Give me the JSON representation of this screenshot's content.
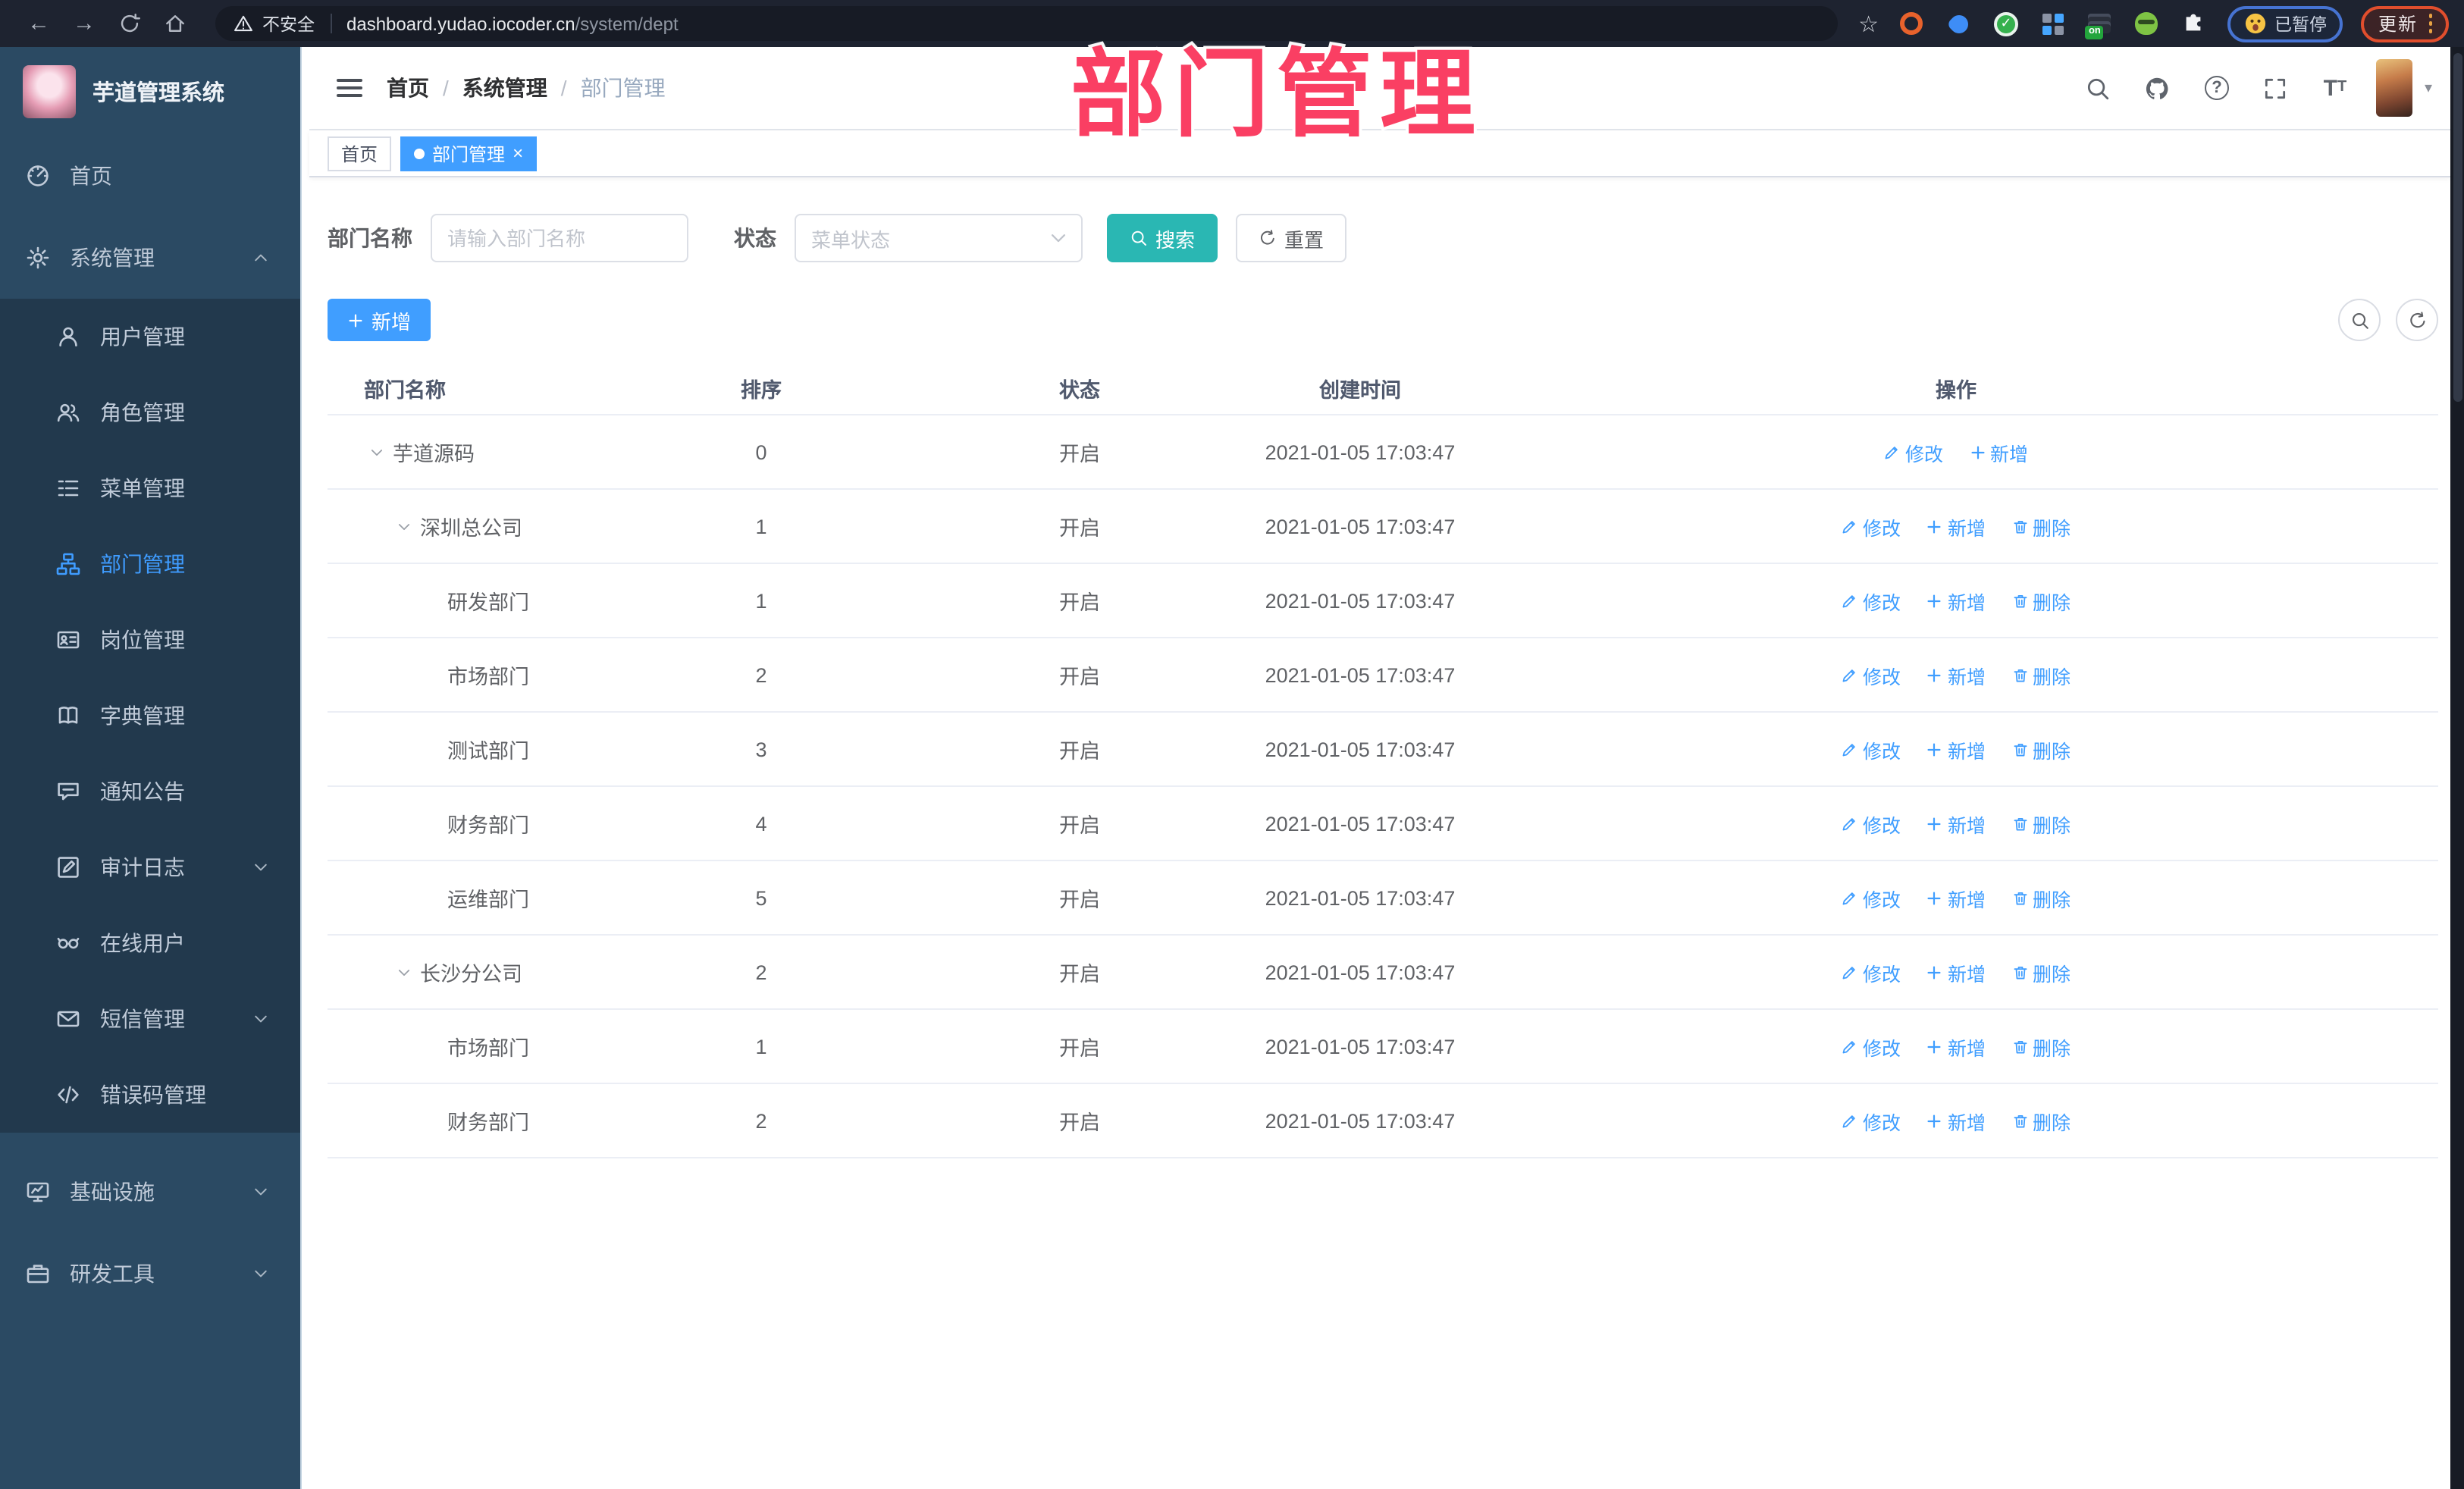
{
  "browser": {
    "nav_icons": [
      "back-icon",
      "forward-icon",
      "reload-icon",
      "home-icon"
    ],
    "security_label": "不安全",
    "url_domain": "dashboard.yudao.iocoder.cn",
    "url_path": "/system/dept",
    "bookmark_icon": "star-icon",
    "extensions": [
      "orange-ring-extension-icon",
      "blue-pin-extension-icon",
      "green-check-extension-icon",
      "grid-extension-icon",
      "panel-on-extension-icon",
      "spy-extension-icon",
      "puzzle-extensions-icon"
    ],
    "extension_badge": "on",
    "green_check": "✓",
    "paused_badge": "已暂停",
    "update_button": "更新"
  },
  "watermark": {
    "text": "部门管理",
    "color": "#fa3f63"
  },
  "sidebar": {
    "logo_title": "芋道管理系统",
    "top_items": [
      {
        "icon": "dashboard-icon",
        "label": "首页"
      },
      {
        "icon": "gear-icon",
        "label": "系统管理",
        "arrow": "up"
      }
    ],
    "submenu_items": [
      {
        "icon": "user-icon",
        "label": "用户管理"
      },
      {
        "icon": "users-icon",
        "label": "角色管理"
      },
      {
        "icon": "menu-list-icon",
        "label": "菜单管理"
      },
      {
        "icon": "org-tree-icon",
        "label": "部门管理",
        "active": true
      },
      {
        "icon": "idcard-icon",
        "label": "岗位管理"
      },
      {
        "icon": "book-icon",
        "label": "字典管理"
      },
      {
        "icon": "megaphone-icon",
        "label": "通知公告"
      },
      {
        "icon": "audit-icon",
        "label": "审计日志",
        "arrow": "down"
      },
      {
        "icon": "goggles-icon",
        "label": "在线用户"
      },
      {
        "icon": "envelope-icon",
        "label": "短信管理",
        "arrow": "down"
      },
      {
        "icon": "code-icon",
        "label": "错误码管理"
      }
    ],
    "bottom_items": [
      {
        "icon": "monitor-icon",
        "label": "基础设施",
        "arrow": "down"
      },
      {
        "icon": "briefcase-icon",
        "label": "研发工具",
        "arrow": "down"
      }
    ]
  },
  "navbar": {
    "breadcrumb": [
      "首页",
      "系统管理",
      "部门管理"
    ],
    "icons": [
      "search-icon",
      "github-icon",
      "help-icon",
      "fullscreen-icon",
      "font-size-icon",
      "avatar",
      "caret-down-icon"
    ]
  },
  "tabs": [
    {
      "label": "首页",
      "active": false,
      "closable": false
    },
    {
      "label": "部门管理",
      "active": true,
      "closable": true
    }
  ],
  "filters": {
    "name_label": "部门名称",
    "name_placeholder": "请输入部门名称",
    "status_label": "状态",
    "status_placeholder": "菜单状态",
    "search_label": "搜索",
    "reset_label": "重置"
  },
  "toolbar": {
    "add_label": "新增"
  },
  "table": {
    "headers": [
      "部门名称",
      "排序",
      "状态",
      "创建时间",
      "操作"
    ],
    "action_labels": {
      "edit": "修改",
      "add": "新增",
      "delete": "删除"
    },
    "rows": [
      {
        "name": "芋道源码",
        "level": 0,
        "caret": true,
        "order": "0",
        "status": "开启",
        "created": "2021-01-05 17:03:47",
        "actions": [
          "edit",
          "add"
        ]
      },
      {
        "name": "深圳总公司",
        "level": 1,
        "caret": true,
        "order": "1",
        "status": "开启",
        "created": "2021-01-05 17:03:47",
        "actions": [
          "edit",
          "add",
          "delete"
        ]
      },
      {
        "name": "研发部门",
        "level": 2,
        "caret": false,
        "order": "1",
        "status": "开启",
        "created": "2021-01-05 17:03:47",
        "actions": [
          "edit",
          "add",
          "delete"
        ]
      },
      {
        "name": "市场部门",
        "level": 2,
        "caret": false,
        "order": "2",
        "status": "开启",
        "created": "2021-01-05 17:03:47",
        "actions": [
          "edit",
          "add",
          "delete"
        ]
      },
      {
        "name": "测试部门",
        "level": 2,
        "caret": false,
        "order": "3",
        "status": "开启",
        "created": "2021-01-05 17:03:47",
        "actions": [
          "edit",
          "add",
          "delete"
        ]
      },
      {
        "name": "财务部门",
        "level": 2,
        "caret": false,
        "order": "4",
        "status": "开启",
        "created": "2021-01-05 17:03:47",
        "actions": [
          "edit",
          "add",
          "delete"
        ]
      },
      {
        "name": "运维部门",
        "level": 2,
        "caret": false,
        "order": "5",
        "status": "开启",
        "created": "2021-01-05 17:03:47",
        "actions": [
          "edit",
          "add",
          "delete"
        ]
      },
      {
        "name": "长沙分公司",
        "level": 1,
        "caret": true,
        "order": "2",
        "status": "开启",
        "created": "2021-01-05 17:03:47",
        "actions": [
          "edit",
          "add",
          "delete"
        ]
      },
      {
        "name": "市场部门",
        "level": 2,
        "caret": false,
        "order": "1",
        "status": "开启",
        "created": "2021-01-05 17:03:47",
        "actions": [
          "edit",
          "add",
          "delete"
        ]
      },
      {
        "name": "财务部门",
        "level": 2,
        "caret": false,
        "order": "2",
        "status": "开启",
        "created": "2021-01-05 17:03:47",
        "actions": [
          "edit",
          "add",
          "delete"
        ]
      }
    ]
  },
  "colors": {
    "accent": "#409eff",
    "search_button_teal": "#2ab7b3",
    "watermark_pink": "#fa3f63",
    "sidebar_bg": "#2b4a63",
    "submenu_bg": "#22394d",
    "active_tab_bg": "#409eff"
  }
}
